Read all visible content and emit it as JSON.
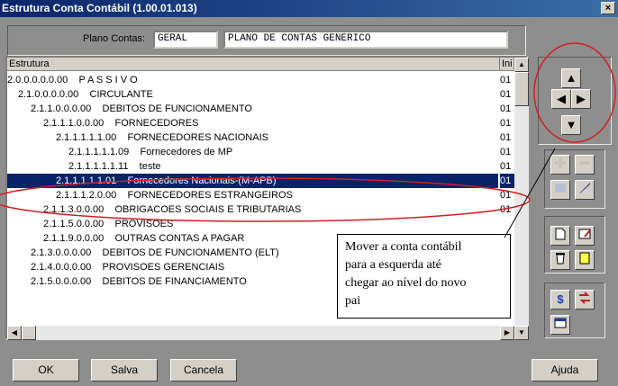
{
  "window": {
    "title": "Estrutura Conta Contábil (1.00.01.013)",
    "close": "×"
  },
  "plano": {
    "label": "Plano Contas:",
    "code": "GERAL",
    "name": "PLANO DE CONTAS GENERICO"
  },
  "tree": {
    "headers": [
      "Estrutura",
      "Ini"
    ],
    "rows": [
      {
        "text": "2.0.0.0.0.0.00    P A S S I V O",
        "ini": "01"
      },
      {
        "text": "2.1.0.0.0.0.00    CIRCULANTE",
        "ini": "01"
      },
      {
        "text": "2.1.1.0.0.0.00    DEBITOS DE FUNCIONAMENTO",
        "ini": "01"
      },
      {
        "text": "2.1.1.1.0.0.00    FORNECEDORES",
        "ini": "01"
      },
      {
        "text": "2.1.1.1.1.1.00    FORNECEDORES NACIONAIS",
        "ini": "01"
      },
      {
        "text": "2.1.1.1.1.1.09    Fornecedores de MP",
        "ini": "01"
      },
      {
        "text": "2.1.1.1.1.1.11    teste",
        "ini": "01"
      },
      {
        "text": "2.1.1.1.1.1.01    Fornecedores Nacionais-(M-APB)",
        "ini": "01"
      },
      {
        "text": "2.1.1.1.2.0.00    FORNECEDORES ESTRANGEIROS",
        "ini": "01"
      },
      {
        "text": "2.1.1.3.0.0.00    OBRIGACOES SOCIAIS E TRIBUTARIAS",
        "ini": "01"
      },
      {
        "text": "2.1.1.5.0.0.00    PROVISOES",
        "ini": ""
      },
      {
        "text": "2.1.1.9.0.0.00    OUTRAS CONTAS A PAGAR",
        "ini": ""
      },
      {
        "text": "2.1.3.0.0.0.00    DEBITOS DE FUNCIONAMENTO (ELT)",
        "ini": ""
      },
      {
        "text": "2.1.4.0.0.0.00    PROVISOES GERENCIAIS",
        "ini": ""
      },
      {
        "text": "2.1.5.0.0.0.00    DEBITOS DE FINANCIAMENTO",
        "ini": ""
      }
    ]
  },
  "callout": "Mover a conta contábil\npara a esquerda até\nchegar ao nível do novo\npai",
  "buttons": {
    "ok": "OK",
    "salva": "Salva",
    "cancela": "Cancela",
    "ajuda": "Ajuda"
  },
  "icons": {
    "up": "▲",
    "left": "◀",
    "right": "▶",
    "down": "▼",
    "dollar": "$"
  },
  "colors": {
    "selection": "#0a246a",
    "annotation": "#d02020"
  }
}
